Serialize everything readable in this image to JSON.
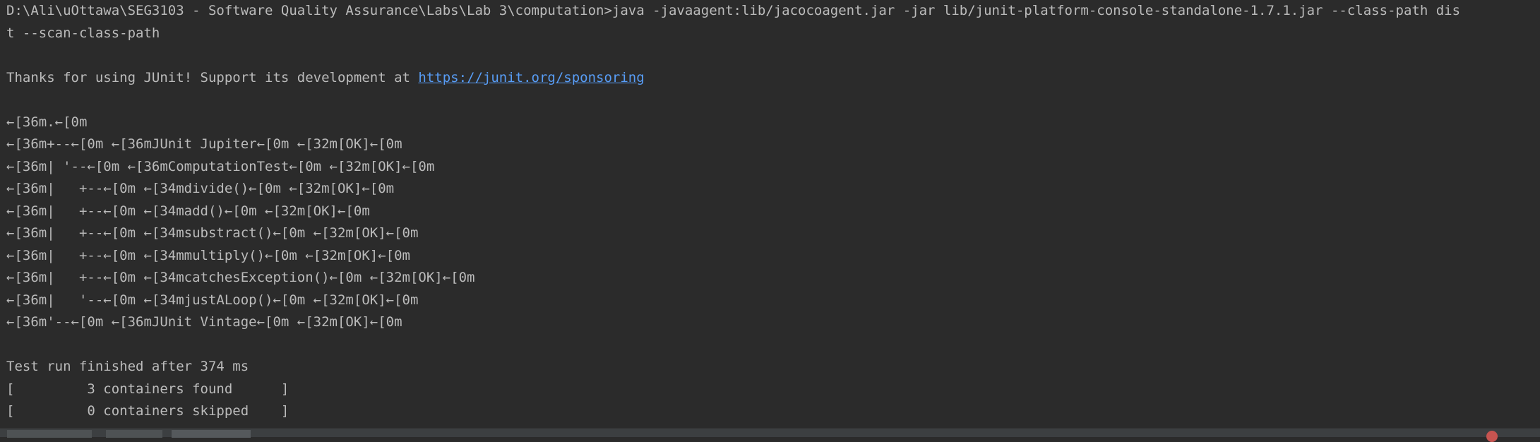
{
  "terminal": {
    "lines": [
      "D:\\Ali\\uOttawa\\SEG3103 - Software Quality Assurance\\Labs\\Lab 3\\computation>java -javaagent:lib/jacocoagent.jar -jar lib/junit-platform-console-standalone-1.7.1.jar --class-path dis",
      "t --scan-class-path",
      "",
      "",
      "",
      "←[36m.←[0m",
      "←[36m+--←[0m ←[36mJUnit Jupiter←[0m ←[32m[OK]←[0m",
      "←[36m| '--←[0m ←[36mComputationTest←[0m ←[32m[OK]←[0m",
      "←[36m|   +--←[0m ←[34mdivide()←[0m ←[32m[OK]←[0m",
      "←[36m|   +--←[0m ←[34madd()←[0m ←[32m[OK]←[0m",
      "←[36m|   +--←[0m ←[34msubstract()←[0m ←[32m[OK]←[0m",
      "←[36m|   +--←[0m ←[34mmultiply()←[0m ←[32m[OK]←[0m",
      "←[36m|   +--←[0m ←[34mcatchesException()←[0m ←[32m[OK]←[0m",
      "←[36m|   '--←[0m ←[34mjustALoop()←[0m ←[32m[OK]←[0m",
      "←[36m'--←[0m ←[36mJUnit Vintage←[0m ←[32m[OK]←[0m",
      "",
      "Test run finished after 374 ms",
      "[         3 containers found      ]",
      "[         0 containers skipped    ]"
    ],
    "thanks_prefix": "Thanks for using JUnit! Support its development at ",
    "sponsor_link": "https://junit.org/sponsoring"
  },
  "colors": {
    "background": "#2b2b2b",
    "text": "#bbbbbb",
    "link": "#589df6"
  }
}
